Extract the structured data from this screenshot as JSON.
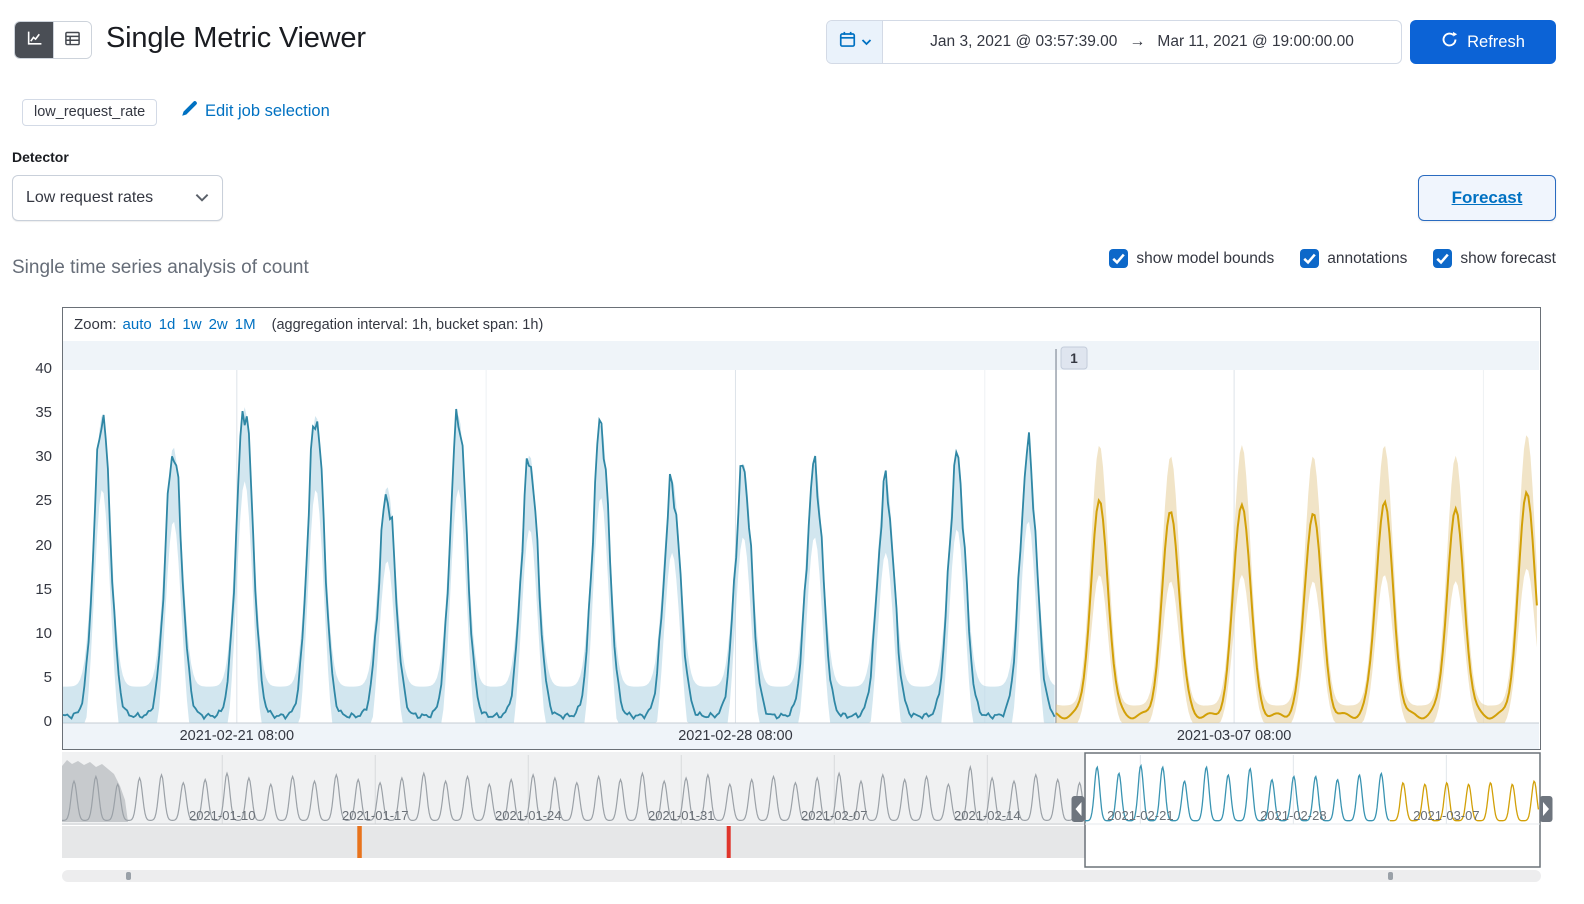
{
  "colors": {
    "link_blue": "#0071c2",
    "refresh_button": "#0c63d6",
    "checkbox": "#0d68c9",
    "actual_line": "#2f87a5",
    "model_bounds_fill": "#a9cfe0",
    "forecast_line": "#d2a008",
    "forecast_bounds_fill": "#e3c98f",
    "annotation_orange": "#e8731c",
    "annotation_red": "#e0352b",
    "context_gray": "#9ba1a7"
  },
  "header": {
    "title": "Single Metric Viewer",
    "datepicker": {
      "start": "Jan 3, 2021 @ 03:57:39.00",
      "arrow": "→",
      "end": "Mar 11, 2021 @ 19:00:00.00"
    },
    "refresh_label": "Refresh"
  },
  "job": {
    "badge": "low_request_rate",
    "edit_link": "Edit job selection"
  },
  "detector": {
    "label": "Detector",
    "selected": "Low request rates"
  },
  "forecast_button_label": "Forecast",
  "section_heading": "Single time series analysis of count",
  "toggles": [
    {
      "label": "show model bounds",
      "checked": true
    },
    {
      "label": "annotations",
      "checked": true
    },
    {
      "label": "show forecast",
      "checked": true
    }
  ],
  "chart": {
    "zoom_label": "Zoom:",
    "zoom_links": [
      "auto",
      "1d",
      "1w",
      "2w",
      "1M"
    ],
    "zoom_suffix": "(aggregation interval: 1h, bucket span: 1h)",
    "annotation_badge": "1"
  },
  "chart_data": {
    "type": "line",
    "title": "Single time series analysis of count",
    "ylim": [
      0,
      40
    ],
    "yticks": [
      0,
      5,
      10,
      15,
      20,
      25,
      30,
      35,
      40
    ],
    "grid": true,
    "x_axis": {
      "days_total": 20.72,
      "tick_days": [
        2.44,
        9.44,
        16.44
      ],
      "tick_labels": [
        "2021-02-21 08:00",
        "2021-02-28 08:00",
        "2021-03-07 08:00"
      ]
    },
    "series": [
      {
        "name": "actual",
        "type": "line",
        "color": "#2f87a5",
        "valley": 0.8,
        "daily_peaks": [
          35,
          31,
          36,
          35,
          26,
          35,
          30,
          34,
          27,
          29,
          29,
          27,
          30,
          31
        ],
        "start_day": 0,
        "end_day": 13.94
      },
      {
        "name": "model bounds",
        "type": "area",
        "fill": "#a9cfe0"
      },
      {
        "name": "forecast",
        "type": "line",
        "color": "#d2a008",
        "valley": 0.8,
        "daily_peaks": [
          25,
          24,
          25,
          24,
          25,
          24,
          26
        ],
        "start_day": 13.94,
        "end_day": 20.72
      },
      {
        "name": "forecast bounds",
        "type": "area",
        "fill": "#e3c98f"
      }
    ],
    "annotation": {
      "label": "1",
      "day": 13.94
    },
    "aggregation_interval": "1h",
    "bucket_span": "1h",
    "context_navigator": {
      "days_total": 67.66,
      "tick_start_day": 7.33,
      "tick_step_days": 7,
      "tick_labels": [
        "2021-01-10",
        "2021-01-17",
        "2021-01-24",
        "2021-01-31",
        "2021-02-07",
        "2021-02-14",
        "2021-02-21",
        "2021-02-28",
        "2021-03-07"
      ],
      "selection_day_range": [
        46.8,
        67.66
      ],
      "forecast_start_day": 60.74,
      "valley": 1,
      "daily_peaks": [
        26,
        29,
        24,
        28,
        30,
        25,
        27,
        31,
        28,
        24,
        29,
        26,
        30,
        27,
        25,
        28,
        31,
        26,
        29,
        24,
        27,
        30,
        28,
        25,
        29,
        27,
        31,
        26,
        28,
        30,
        24,
        27,
        29,
        25,
        28,
        31,
        26,
        30,
        27,
        29,
        24,
        35,
        28,
        26,
        30,
        27,
        25,
        29,
        31,
        26,
        28,
        30,
        25,
        27,
        29,
        26,
        31,
        28,
        24,
        30,
        27,
        29,
        25,
        28,
        30,
        26,
        29,
        27
      ],
      "annotation_marker_days": [
        13.6,
        30.5
      ]
    }
  }
}
